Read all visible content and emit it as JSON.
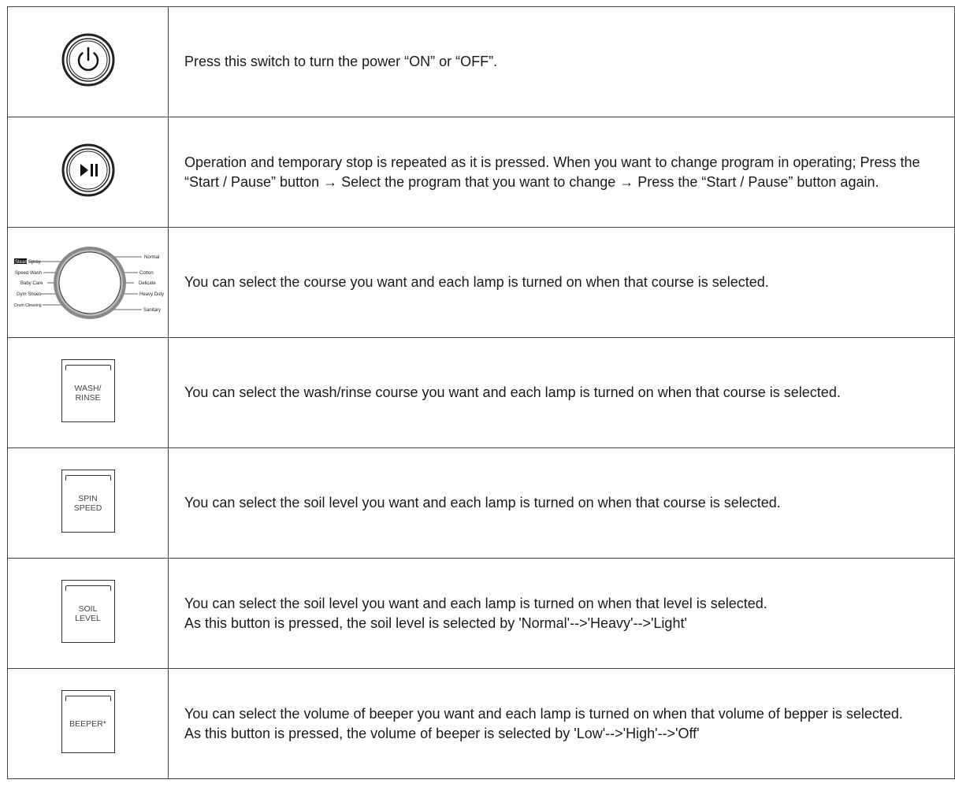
{
  "rows": [
    {
      "icon": "power-button-icon",
      "description": "Press this switch to turn the power “ON” or “OFF”."
    },
    {
      "icon": "start-pause-button-icon",
      "description": "Operation and temporary stop is repeated as it is pressed. When you want to change program in operating; Press the “Start / Pause” button → Select the program that you want to change → Press the “Start / Pause” button again."
    },
    {
      "icon": "course-dial-icon",
      "dial": {
        "left_labels": [
          "Steam",
          "Spray",
          "Speed Wash",
          "Baby Care",
          "Gym Shoes",
          "Drum Cleaning"
        ],
        "right_labels": [
          "Normal",
          "Cotton",
          "Delicate",
          "Heavy Duty",
          "Sanitary"
        ]
      },
      "description": "You can select the course you want and each lamp is turned on when that course is selected."
    },
    {
      "icon": "wash-rinse-button-icon",
      "key_label": "WASH/\nRINSE",
      "description": "You can select the wash/rinse course you want and each lamp is turned on when that course is selected."
    },
    {
      "icon": "spin-speed-button-icon",
      "key_label": "SPIN\nSPEED",
      "description": "You can select the soil level you want and each lamp is turned on when that course is selected."
    },
    {
      "icon": "soil-level-button-icon",
      "key_label": "SOIL\nLEVEL",
      "description": "You can select the soil level you want and each lamp is turned on when that level is selected.\nAs this button is pressed, the soil level is selected by 'Normal'-->'Heavy'-->'Light'"
    },
    {
      "icon": "beeper-button-icon",
      "key_label": "BEEPER*",
      "description": "You can select the volume of beeper you want and each lamp is turned on when that volume of bepper is selected.\nAs this button is pressed, the volume of beeper is selected by 'Low'-->'High'-->'Off'"
    }
  ]
}
